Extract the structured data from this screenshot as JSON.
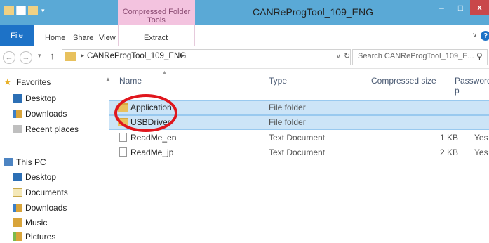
{
  "window": {
    "title": "CANReProgTool_109_ENG",
    "contextual_tab_group": "Compressed Folder Tools",
    "controls": {
      "minimize": "–",
      "maximize": "□",
      "close": "x"
    }
  },
  "ribbon": {
    "tabs": [
      "File",
      "Home",
      "Share",
      "View",
      "Extract"
    ],
    "expand_symbol": "∨",
    "help_symbol": "?"
  },
  "address_bar": {
    "path": "CANReProgTool_109_ENG",
    "separator": "▸",
    "dropdown": "∨",
    "refresh": "↻"
  },
  "search": {
    "placeholder": "Search CANReProgTool_109_E..."
  },
  "sidebar": {
    "favorites": {
      "label": "Favorites",
      "items": [
        "Desktop",
        "Downloads",
        "Recent places"
      ]
    },
    "this_pc": {
      "label": "This PC",
      "items": [
        "Desktop",
        "Documents",
        "Downloads",
        "Music",
        "Pictures"
      ]
    }
  },
  "file_list": {
    "columns": [
      "Name",
      "Type",
      "Compressed size",
      "Password p"
    ],
    "rows": [
      {
        "name": "Application",
        "type": "File folder",
        "size": "",
        "password": "",
        "selected": true
      },
      {
        "name": "USBDriver",
        "type": "File folder",
        "size": "",
        "password": "",
        "selected": true
      },
      {
        "name": "ReadMe_en",
        "type": "Text Document",
        "size": "1 KB",
        "password": "Yes",
        "selected": false
      },
      {
        "name": "ReadMe_jp",
        "type": "Text Document",
        "size": "2 KB",
        "password": "Yes",
        "selected": false
      }
    ]
  },
  "colors": {
    "title_bar": "#5aa9d6",
    "contextual_tab": "#f3c3df",
    "file_tab": "#1d72c7",
    "selection": "#cce4f7",
    "annotation": "#e0161d"
  }
}
